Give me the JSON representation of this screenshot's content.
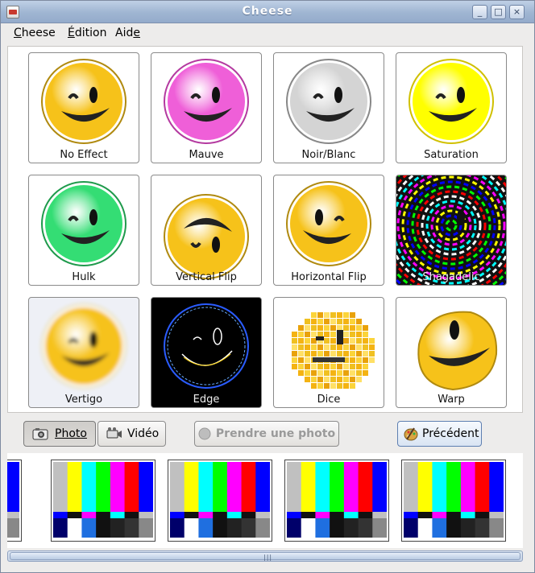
{
  "window": {
    "title": "Cheese"
  },
  "menubar": {
    "items": [
      {
        "label": "Cheese",
        "ul": "C",
        "rest": "heese"
      },
      {
        "label": "Édition",
        "ul": "É",
        "rest": "dition"
      },
      {
        "label": "Aide",
        "ul_prefix": "Aid",
        "ul": "e"
      }
    ]
  },
  "effects": [
    {
      "label": "No Effect"
    },
    {
      "label": "Mauve"
    },
    {
      "label": "Noir/Blanc"
    },
    {
      "label": "Saturation"
    },
    {
      "label": "Hulk"
    },
    {
      "label": "Vertical Flip"
    },
    {
      "label": "Horizontal Flip"
    },
    {
      "label": "Shagadelic"
    },
    {
      "label": "Vertigo"
    },
    {
      "label": "Edge"
    },
    {
      "label": "Dice"
    },
    {
      "label": "Warp"
    }
  ],
  "toolbar": {
    "photo_label": "Photo",
    "video_label": "Vidéo",
    "take_photo_label": "Prendre une photo",
    "previous_label": "Précédent"
  },
  "colors": {
    "face_yellow": "#f9c91a",
    "face_mauve": "#f062d8",
    "face_grey": "#d8d8d8",
    "face_green": "#3ddc7a",
    "title_bar": "#9fb5d2"
  },
  "thumbnails": {
    "count": 5
  }
}
